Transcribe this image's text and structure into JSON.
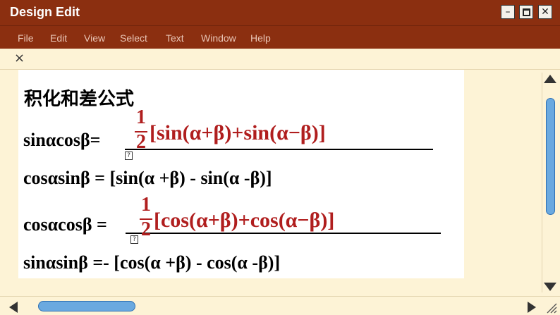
{
  "window": {
    "title": "Design Edit"
  },
  "menu": [
    "File",
    "Edit",
    "View",
    "Select",
    "Text",
    "Window",
    "Help"
  ],
  "toolbar": {
    "close_glyph": "×"
  },
  "content": {
    "heading": "积化和差公式",
    "line1": {
      "lhs": "sinαcosβ=",
      "coef_num": "1",
      "coef_den": "2",
      "expr": "[sin(α+β)+sin(α−β)]"
    },
    "line2": {
      "text": "cosαsinβ =   [sin(α +β) - sin(α -β)]"
    },
    "line3": {
      "lhs": "cosαcosβ =",
      "coef_num": "1",
      "coef_den": "2",
      "expr": "[cos(α+β)+cos(α−β)]"
    },
    "line4": {
      "text": "sinαsinβ =-  [cos(α +β) - cos(α -β)]"
    }
  },
  "colors": {
    "titlebar": "#8b2f10",
    "background": "#fdf3d6",
    "formula_red": "#b01e1e",
    "scroll_thumb": "#6aa9e0"
  },
  "icons": {
    "minimize": "minimize-icon",
    "maximize": "maximize-icon",
    "close": "close-icon",
    "formula_placeholder": "placeholder-image-icon"
  }
}
